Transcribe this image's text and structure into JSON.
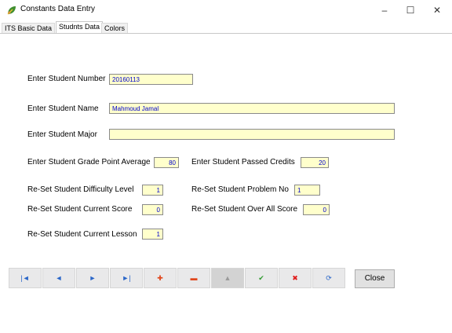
{
  "window": {
    "title": "Constants Data Entry",
    "minimize": "–",
    "maximize": "☐",
    "close": "✕"
  },
  "tabs": [
    {
      "label": "ITS Basic Data"
    },
    {
      "label": "Studnts Data"
    },
    {
      "label": "Colors"
    }
  ],
  "form": {
    "student_number": {
      "label": "Enter Student Number",
      "value": "20160113"
    },
    "student_name": {
      "label": "Enter Student Name",
      "value": "Mahmoud Jamal"
    },
    "student_major": {
      "label": "Enter Student Major",
      "value": ""
    },
    "grade_point_average": {
      "label": "Enter Student Grade Point Average",
      "value": "80"
    },
    "passed_credits": {
      "label": "Enter Student Passed Credits",
      "value": "20"
    },
    "difficulty_level": {
      "label": "Re-Set Student Difficulty Level",
      "value": "1"
    },
    "problem_no": {
      "label": "Re-Set Student Problem No",
      "value": "1"
    },
    "current_score": {
      "label": "Re-Set Student Current Score",
      "value": "0"
    },
    "over_all_score": {
      "label": "Re-Set Student Over All Score",
      "value": "0"
    },
    "current_lesson": {
      "label": "Re-Set Student Current Lesson",
      "value": "1"
    }
  },
  "navigator": {
    "first": {
      "glyph": "|◄",
      "color": "#2a66c8"
    },
    "prior": {
      "glyph": "◄",
      "color": "#2a66c8"
    },
    "next": {
      "glyph": "►",
      "color": "#2a66c8"
    },
    "last": {
      "glyph": "►|",
      "color": "#2a66c8"
    },
    "insert": {
      "glyph": "✚",
      "color": "#e0461c"
    },
    "delete": {
      "glyph": "▬",
      "color": "#e0461c"
    },
    "edit": {
      "glyph": "▲",
      "color": "#9a9a9a"
    },
    "post": {
      "glyph": "✔",
      "color": "#2e9a2e"
    },
    "cancel": {
      "glyph": "✖",
      "color": "#e01c1c"
    },
    "refresh": {
      "glyph": "⟳",
      "color": "#2a66c8"
    }
  },
  "close_button": {
    "label": "Close"
  }
}
